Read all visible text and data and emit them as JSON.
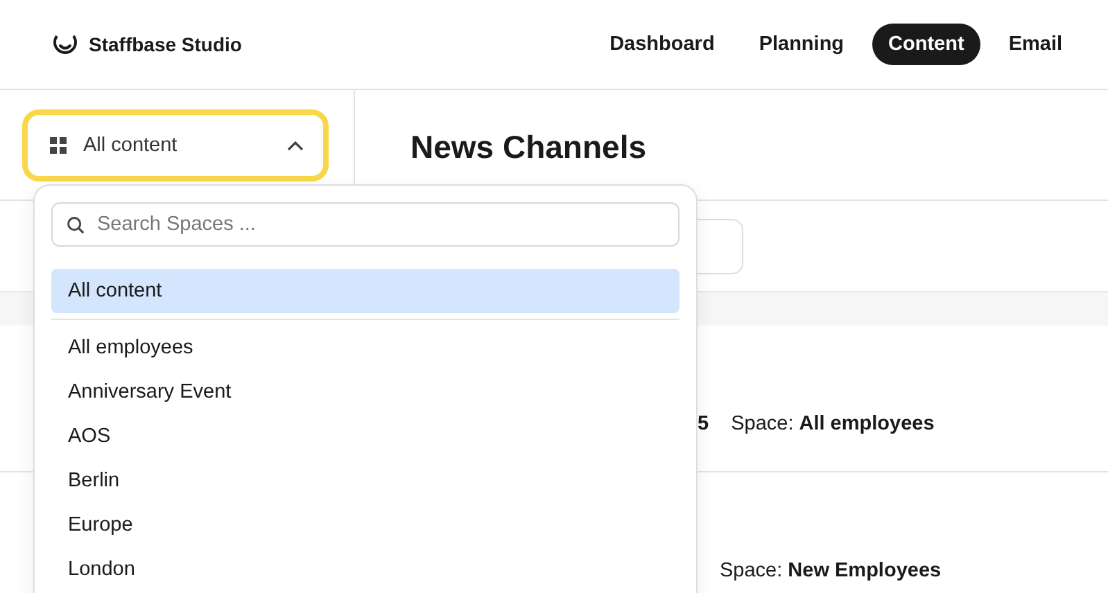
{
  "brand": {
    "name": "Staffbase Studio"
  },
  "nav": [
    {
      "label": "Dashboard",
      "selected": false
    },
    {
      "label": "Planning",
      "selected": false
    },
    {
      "label": "Content",
      "selected": true
    },
    {
      "label": "Email",
      "selected": false
    }
  ],
  "space_select": {
    "value": "All content",
    "expanded": true
  },
  "page_title": "News Channels",
  "rows": [
    {
      "column_1": "5",
      "space": "Space: **All employees**"
    },
    {
      "space": "Space: **New Employees**"
    }
  ],
  "dropdown": {
    "search": {
      "placeholder": "Search Spaces ..."
    },
    "items": [
      {
        "label": "All content",
        "selected": true
      },
      {
        "label": "All employees",
        "selected": false
      },
      {
        "label": "Anniversary Event",
        "selected": false
      },
      {
        "label": "AOS",
        "selected": false
      },
      {
        "label": "Berlin",
        "selected": false
      },
      {
        "label": "Europe",
        "selected": false
      },
      {
        "label": "London",
        "selected": false
      }
    ]
  }
}
